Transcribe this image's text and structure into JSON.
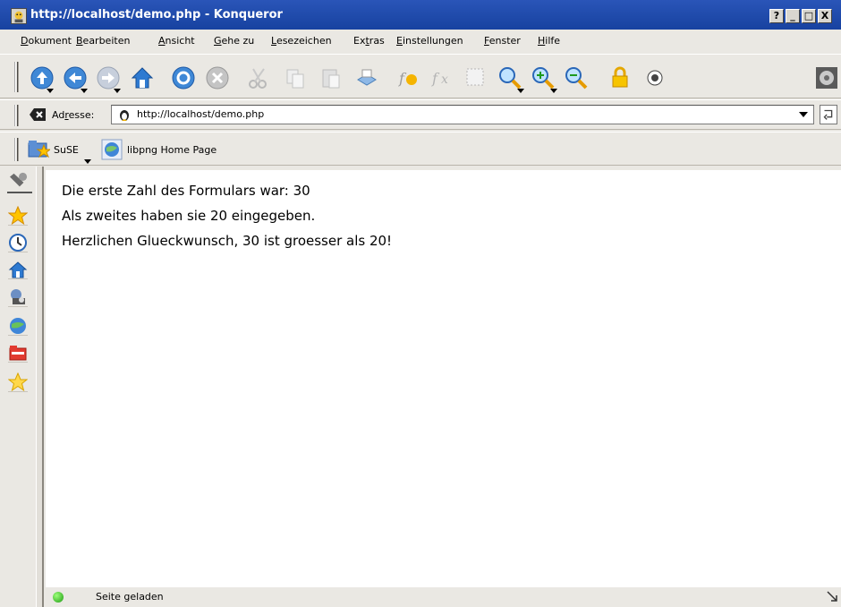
{
  "window": {
    "title": "http://localhost/demo.php - Konqueror",
    "help_btn": "?",
    "min_btn": "_",
    "max_btn": "□",
    "close_btn": "X"
  },
  "menubar": {
    "items": [
      {
        "u": "D",
        "rest": "okument"
      },
      {
        "u": "B",
        "rest": "earbeiten"
      },
      {
        "u": "A",
        "rest": "nsicht"
      },
      {
        "u": "G",
        "rest": "ehe zu"
      },
      {
        "u": "L",
        "rest": "esezeichen"
      },
      {
        "pre": "Ex",
        "u": "t",
        "rest": "ras"
      },
      {
        "u": "E",
        "rest": "instellungen"
      },
      {
        "u": "F",
        "rest": "enster"
      },
      {
        "u": "H",
        "rest": "ilfe"
      }
    ]
  },
  "toolbar": {
    "icons": [
      "up-icon",
      "back-icon",
      "forward-icon",
      "home-icon",
      "reload-icon",
      "stop-icon",
      "cut-icon",
      "copy-icon",
      "paste-icon",
      "print-icon",
      "increase-font-icon",
      "decrease-font-icon",
      "find-icon",
      "zoom-icon",
      "zoom-in-icon",
      "zoom-out-icon",
      "lock-icon",
      "security-icon",
      "konqueror-activity-icon"
    ]
  },
  "location": {
    "label_pre": "Ad",
    "label_u": "r",
    "label_post": "esse:",
    "url": "http://localhost/demo.php"
  },
  "bookmarks": {
    "items": [
      {
        "label": "SuSE",
        "icon": "folder-star-icon"
      },
      {
        "label": "libpng Home Page",
        "icon": "globe-icon"
      }
    ]
  },
  "content": {
    "lines": [
      "Die erste Zahl des Formulars war: 30",
      "Als zweites haben sie 20 eingegeben.",
      "Herzlichen Glueckwunsch, 30 ist groesser als 20!"
    ]
  },
  "status": {
    "text": "Seite geladen"
  },
  "colors": {
    "titlebar": "#1f4aaa",
    "chrome": "#eae8e3",
    "status_led": "#1c9a12"
  }
}
